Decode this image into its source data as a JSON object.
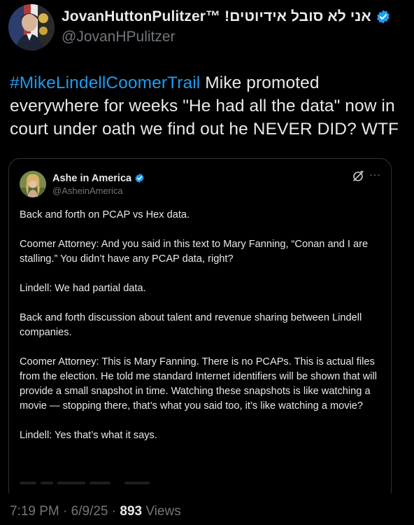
{
  "author": {
    "display_name": "JovanHuttonPulitzer™ !אני לא סובל אידיוטים",
    "handle": "@JovanHPulitzer",
    "verified_color": "#1d9bf0"
  },
  "tweet": {
    "hashtag": "#MikeLindellCoomerTrail",
    "text": " Mike promoted everywhere for weeks \"He had all the data\" now in court under oath we find out he NEVER DID? WTF"
  },
  "quote": {
    "display_name": "Ashe in America",
    "handle": "@AsheinAmerica",
    "icons": [
      "grok-icon",
      "more-icon"
    ],
    "paragraphs": [
      "Back and forth on PCAP vs Hex data.",
      "Coomer Attorney: And you said in this text to Mary Fanning, “Conan and I are stalling.” You didn’t have any PCAP data, right?",
      "Lindell: We had partial data.",
      "Back and forth discussion about talent and revenue sharing between Lindell companies.",
      "Coomer Attorney: This is Mary Fanning. There is no PCAPs. This is actual files from the election. He told me standard Internet identifiers will be shown that will provide a small snapshot in time. Watching these snapshots is like watching a movie — stopping there, that’s what you said too, it’s like watching a movie?",
      "Lindell: Yes that’s what it says."
    ],
    "more_label": "···"
  },
  "footer": {
    "time": "7:19 PM",
    "sep1": " · ",
    "date": "6/9/25",
    "sep2": " · ",
    "views_count": "893",
    "views_label": " Views"
  },
  "colors": {
    "background": "#000000",
    "text": "#e7e9ea",
    "muted": "#71767b",
    "accent": "#1d9bf0",
    "border": "#2f3336"
  }
}
